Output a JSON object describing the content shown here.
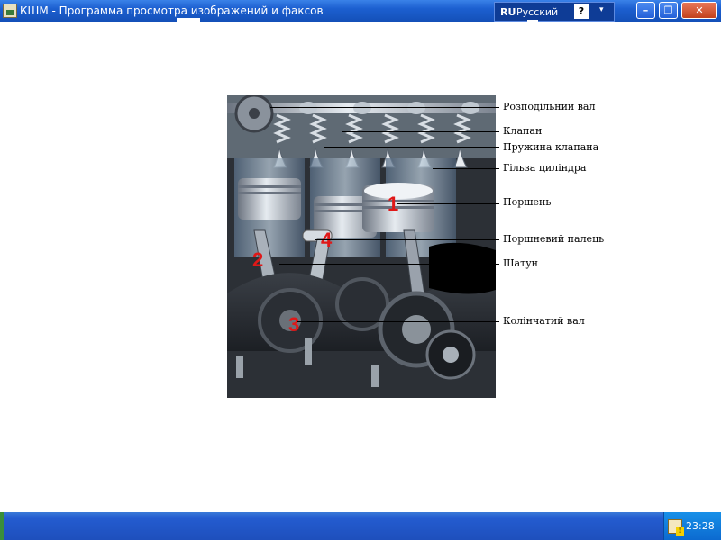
{
  "window": {
    "title": "КШМ - Программа просмотра изображений и факсов",
    "minimize_glyph": "–",
    "maximize_glyph": "❐",
    "close_glyph": "✕"
  },
  "language_bar": {
    "code": "RU",
    "name": "Русский",
    "help_glyph": "?",
    "menu_glyph": "▾"
  },
  "figure": {
    "callouts": [
      {
        "label": "Розподільний вал"
      },
      {
        "label": "Клапан"
      },
      {
        "label": "Пружина клапана"
      },
      {
        "label": "Гільза циліндра"
      },
      {
        "label": "Поршень"
      },
      {
        "label": "Поршневий палець"
      },
      {
        "label": "Шатун"
      },
      {
        "label": "Колінчатий вал"
      }
    ],
    "markers": [
      {
        "number": "1",
        "color": "#e01818"
      },
      {
        "number": "2",
        "color": "#e01818"
      },
      {
        "number": "3",
        "color": "#e01818"
      },
      {
        "number": "4",
        "color": "#e01818"
      }
    ]
  },
  "taskbar": {
    "clock": "23:28"
  },
  "colors": {
    "titlebar": "#1c5fd0",
    "taskbar": "#245cd0",
    "marker_red": "#e01818"
  }
}
